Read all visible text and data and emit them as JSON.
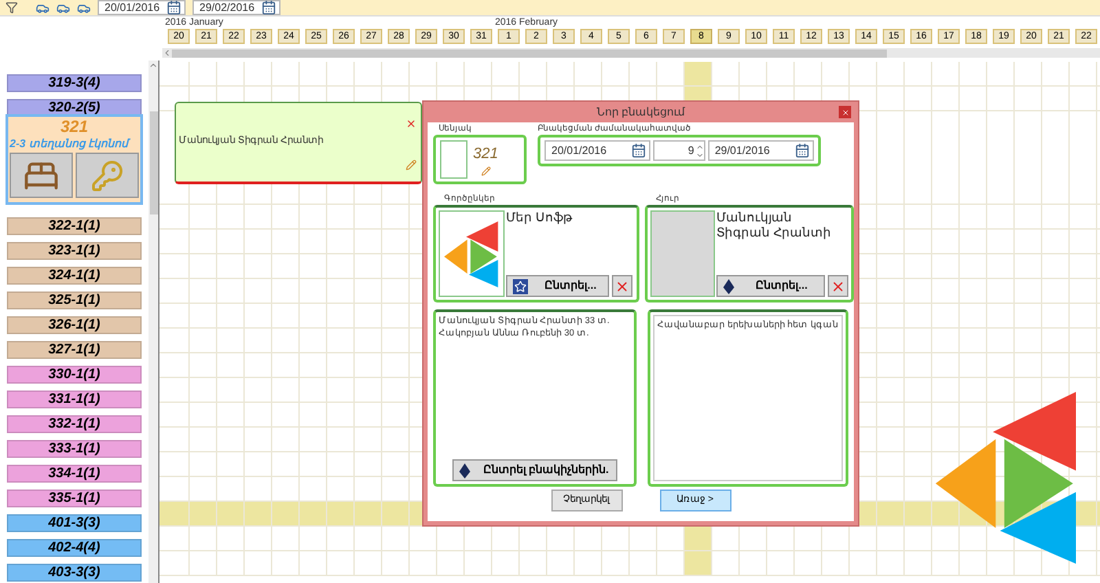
{
  "toolbar": {
    "date_from": "20/01/2016",
    "date_to": "29/02/2016"
  },
  "days": [
    {
      "label": "20",
      "month": "2016 January",
      "highlighted": false
    },
    {
      "label": "21",
      "highlighted": false
    },
    {
      "label": "22",
      "highlighted": false
    },
    {
      "label": "23",
      "highlighted": false
    },
    {
      "label": "24",
      "highlighted": false
    },
    {
      "label": "25",
      "highlighted": false
    },
    {
      "label": "26",
      "highlighted": false
    },
    {
      "label": "27",
      "highlighted": false
    },
    {
      "label": "28",
      "highlighted": false
    },
    {
      "label": "29",
      "highlighted": false
    },
    {
      "label": "30",
      "highlighted": false
    },
    {
      "label": "31",
      "highlighted": false
    },
    {
      "label": "1",
      "month": "2016 February",
      "highlighted": false
    },
    {
      "label": "2",
      "highlighted": false
    },
    {
      "label": "3",
      "highlighted": false
    },
    {
      "label": "4",
      "highlighted": false
    },
    {
      "label": "5",
      "highlighted": false
    },
    {
      "label": "6",
      "highlighted": false
    },
    {
      "label": "7",
      "highlighted": false
    },
    {
      "label": "8",
      "highlighted": true
    },
    {
      "label": "9",
      "highlighted": false
    },
    {
      "label": "10",
      "highlighted": false
    },
    {
      "label": "11",
      "highlighted": false
    },
    {
      "label": "12",
      "highlighted": false
    },
    {
      "label": "13",
      "highlighted": false
    },
    {
      "label": "14",
      "highlighted": false
    },
    {
      "label": "15",
      "highlighted": false
    },
    {
      "label": "16",
      "highlighted": false
    },
    {
      "label": "17",
      "highlighted": false
    },
    {
      "label": "18",
      "highlighted": false
    },
    {
      "label": "19",
      "highlighted": false
    },
    {
      "label": "20",
      "highlighted": false
    },
    {
      "label": "21",
      "highlighted": false
    },
    {
      "label": "22",
      "highlighted": false
    }
  ],
  "rooms": [
    {
      "label": "319-3(4)",
      "color": "#a7a7ea",
      "selected": false,
      "highlighted": false
    },
    {
      "label": "320-2(5)",
      "color": "#a7a7ea",
      "selected": false,
      "highlighted": false
    },
    {
      "label": "321",
      "type": "2-3 տեղանոց էկոնոմ",
      "color": "#fde0bc",
      "selected": true,
      "highlighted": false
    },
    {
      "label": "322-1(1)",
      "color": "#e2c6aa",
      "selected": false,
      "highlighted": false
    },
    {
      "label": "323-1(1)",
      "color": "#e2c6aa",
      "selected": false,
      "highlighted": false
    },
    {
      "label": "324-1(1)",
      "color": "#e2c6aa",
      "selected": false,
      "highlighted": false
    },
    {
      "label": "325-1(1)",
      "color": "#e2c6aa",
      "selected": false,
      "highlighted": false
    },
    {
      "label": "326-1(1)",
      "color": "#e2c6aa",
      "selected": false,
      "highlighted": false
    },
    {
      "label": "327-1(1)",
      "color": "#e2c6aa",
      "selected": false,
      "highlighted": false
    },
    {
      "label": "330-1(1)",
      "color": "#eca2dc",
      "selected": false,
      "highlighted": false
    },
    {
      "label": "331-1(1)",
      "color": "#eca2dc",
      "selected": false,
      "highlighted": false
    },
    {
      "label": "332-1(1)",
      "color": "#eca2dc",
      "selected": false,
      "highlighted": false
    },
    {
      "label": "333-1(1)",
      "color": "#eca2dc",
      "selected": false,
      "highlighted": false
    },
    {
      "label": "334-1(1)",
      "color": "#eca2dc",
      "selected": false,
      "highlighted": false
    },
    {
      "label": "335-1(1)",
      "color": "#eca2dc",
      "selected": false,
      "highlighted": false
    },
    {
      "label": "401-3(3)",
      "color": "#74bcf4",
      "selected": false,
      "highlighted": true
    },
    {
      "label": "402-4(4)",
      "color": "#74bcf4",
      "selected": false,
      "highlighted": false
    },
    {
      "label": "403-3(3)",
      "color": "#74bcf4",
      "selected": false,
      "highlighted": false
    }
  ],
  "booking": {
    "guest": "Մանուկյան Տիգրան Հրանտի"
  },
  "dialog": {
    "title": "Նոր բնակեցում",
    "room": {
      "label": "Սենյակ",
      "number": "321"
    },
    "period": {
      "label": "Բնակեցման ժամանակահատված",
      "from": "20/01/2016",
      "nights": "9",
      "to": "29/01/2016"
    },
    "partner": {
      "label": "Գործընկեր",
      "name": "Մեր Սոֆթ",
      "choose": "Ընտրել..."
    },
    "guest": {
      "label": "Հյուր",
      "name": "Մանուկյան Տիգրան Հրանտի",
      "choose": "Ընտրել..."
    },
    "residents": {
      "lines": [
        "Մանուկյան Տիգրան Հրանտի 33 տ.",
        "Հակոբյան Աննա Ռուբենի 30 տ."
      ],
      "choose": "Ընտրել բնակիչներին."
    },
    "notes": "Հավանաբար երեխաների հետ կգան",
    "buttons": [
      {
        "label": "Չեղարկել",
        "kind": "cancel"
      },
      {
        "label": "Առաջ >",
        "kind": "next"
      }
    ]
  }
}
